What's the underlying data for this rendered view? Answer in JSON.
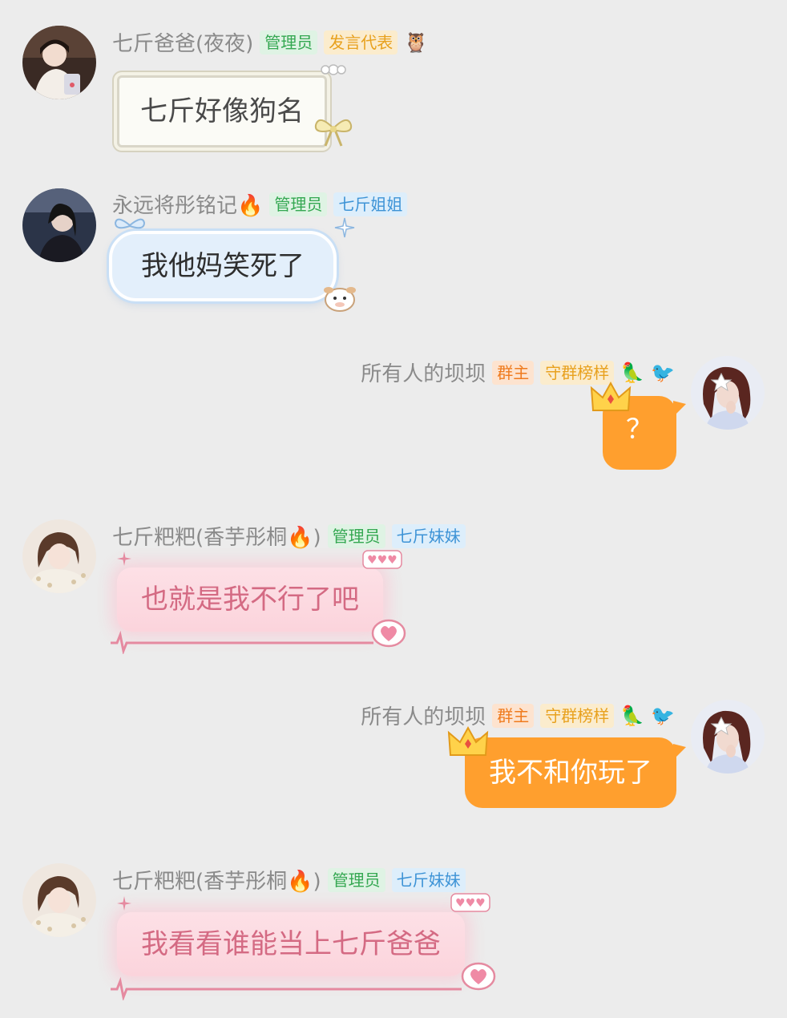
{
  "messages": [
    {
      "sender": "七斤爸爸(夜夜)",
      "badges": [
        "管理员",
        "发言代表"
      ],
      "icon": "owl-icon",
      "text": "七斤好像狗名"
    },
    {
      "sender": "永远将彤铭记🔥",
      "badges": [
        "管理员",
        "七斤姐姐"
      ],
      "text": "我他妈笑死了"
    },
    {
      "sender": "所有人的坝坝",
      "badges": [
        "群主",
        "守群榜样"
      ],
      "icons": [
        "parrot-icon",
        "bird-icon"
      ],
      "text": "？"
    },
    {
      "sender": "七斤粑粑(香芋彤桐🔥)",
      "badges": [
        "管理员",
        "七斤妹妹"
      ],
      "text": "也就是我不行了吧"
    },
    {
      "sender": "所有人的坝坝",
      "badges": [
        "群主",
        "守群榜样"
      ],
      "icons": [
        "parrot-icon",
        "bird-icon"
      ],
      "text": "我不和你玩了"
    },
    {
      "sender": "七斤粑粑(香芋彤桐🔥)",
      "badges": [
        "管理员",
        "七斤妹妹"
      ],
      "text": "我看看谁能当上七斤爸爸"
    }
  ],
  "colors": {
    "background": "#ececec",
    "admin_badge": "#35a852",
    "owner_badge": "#ef7b1e",
    "orange_bubble": "#ff9f2e",
    "pink_text": "#d46a83"
  }
}
